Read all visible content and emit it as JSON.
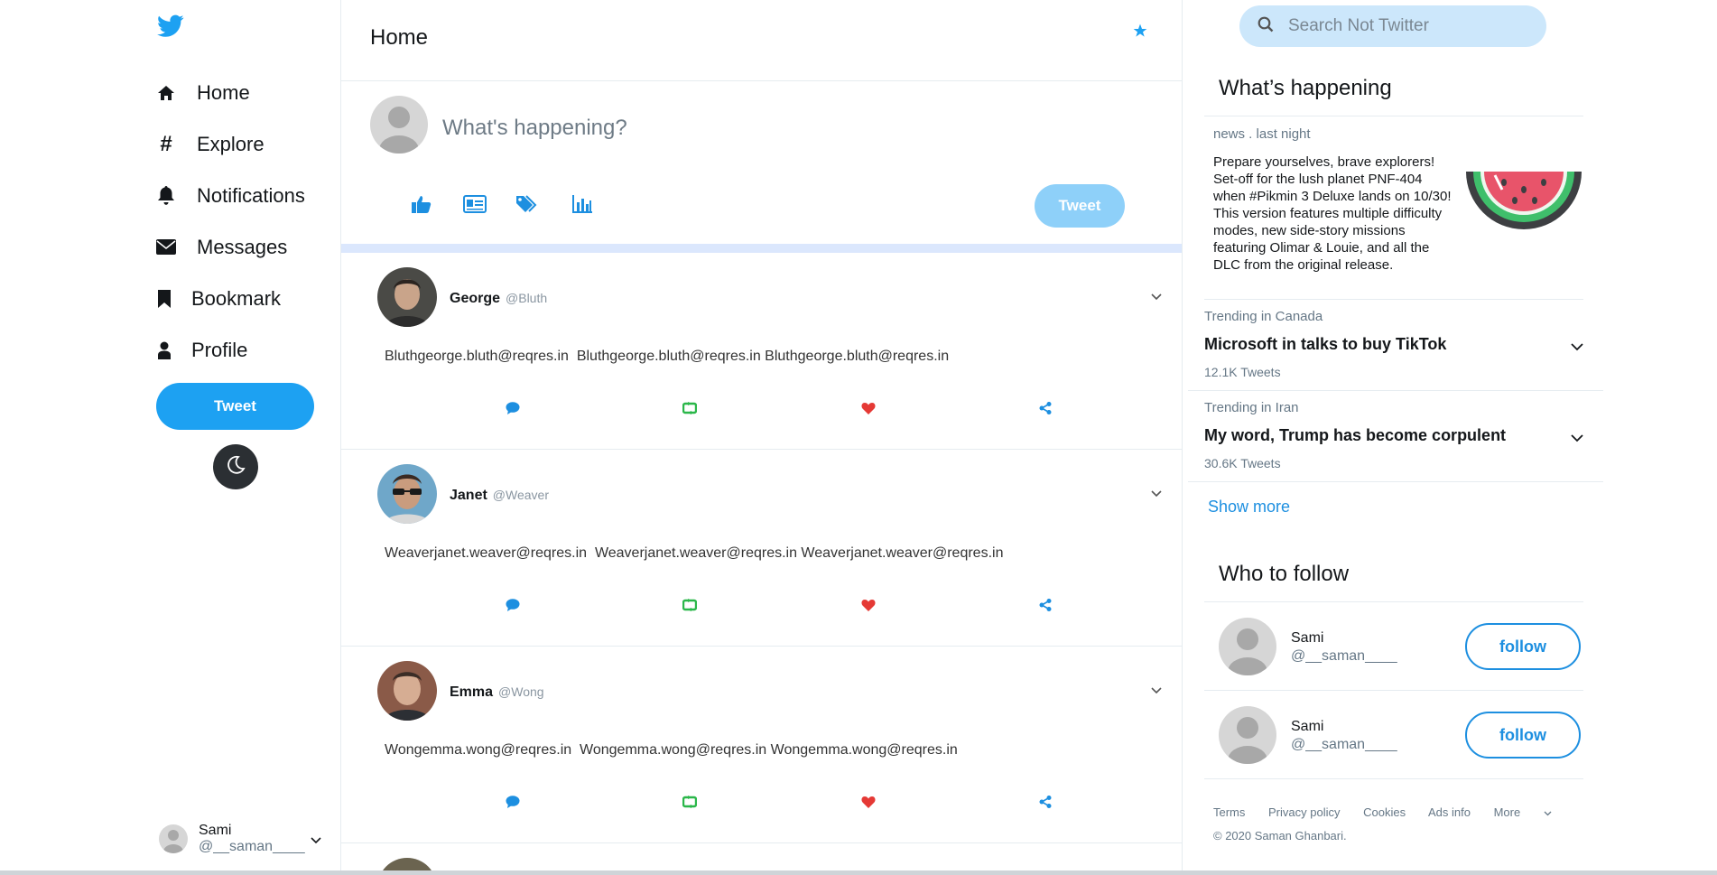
{
  "app": {
    "brand_color": "#1da1f2"
  },
  "nav": {
    "items": [
      {
        "label": "Home",
        "icon": "home-icon"
      },
      {
        "label": "Explore",
        "icon": "hashtag-icon"
      },
      {
        "label": "Notifications",
        "icon": "bell-icon"
      },
      {
        "label": "Messages",
        "icon": "envelope-icon"
      },
      {
        "label": "Bookmark",
        "icon": "bookmark-icon"
      },
      {
        "label": "Profile",
        "icon": "user-icon"
      }
    ],
    "tweet_label": "Tweet"
  },
  "account": {
    "name": "Sami",
    "handle": "@__saman____"
  },
  "main": {
    "title": "Home",
    "composer": {
      "placeholder": "What's happening?",
      "tweet_label": "Tweet"
    },
    "posts": [
      {
        "name": "George",
        "handle": "@Bluth",
        "body": "Bluthgeorge.bluth@reqres.in  Bluthgeorge.bluth@reqres.in Bluthgeorge.bluth@reqres.in"
      },
      {
        "name": "Janet",
        "handle": "@Weaver",
        "body": "Weaverjanet.weaver@reqres.in  Weaverjanet.weaver@reqres.in Weaverjanet.weaver@reqres.in"
      },
      {
        "name": "Emma",
        "handle": "@Wong",
        "body": "Wongemma.wong@reqres.in  Wongemma.wong@reqres.in Wongemma.wong@reqres.in"
      }
    ]
  },
  "sidebar": {
    "search_placeholder": "Search Not Twitter",
    "happening": {
      "title": "What’s happening",
      "news": {
        "meta": "news . last night",
        "text": "Prepare yourselves, brave explorers! Set-off for the lush planet PNF-404 when #Pikmin 3 Deluxe lands on 10/30! This version features multiple difficulty modes, new side-story missions featuring Olimar & Louie, and all the DLC from the original release."
      },
      "trends": [
        {
          "meta": "Trending in Canada",
          "topic": "Microsoft in talks to buy TikTok",
          "count": "12.1K Tweets"
        },
        {
          "meta": "Trending in Iran",
          "topic": "My word, Trump has become corpulent",
          "count": "30.6K Tweets"
        }
      ],
      "show_more": "Show more"
    },
    "who_to_follow": {
      "title": "Who to follow",
      "users": [
        {
          "name": "Sami",
          "handle": "@__saman____",
          "button": "follow"
        },
        {
          "name": "Sami",
          "handle": "@__saman____",
          "button": "follow"
        }
      ]
    },
    "footer": {
      "links": [
        "Terms",
        "Privacy policy",
        "Cookies",
        "Ads info",
        "More"
      ],
      "copyright": "© 2020 Saman Ghanbari."
    }
  }
}
